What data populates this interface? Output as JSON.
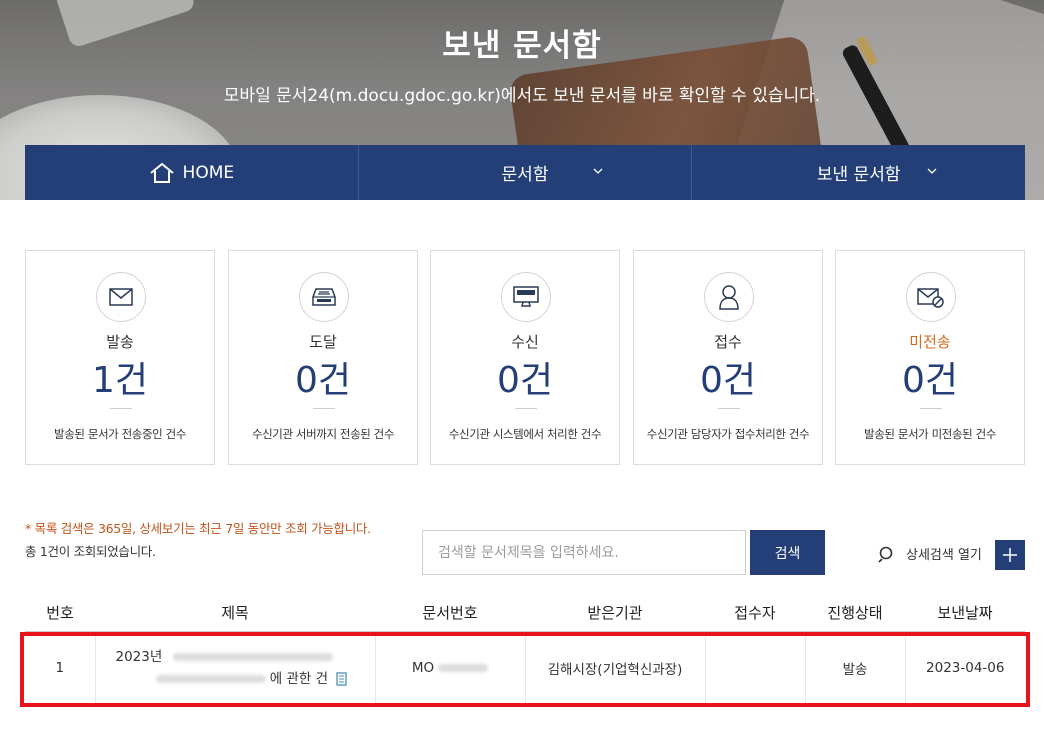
{
  "hero": {
    "title": "보낸 문서함",
    "subtitle": "모바일 문서24(m.docu.gdoc.go.kr)에서도 보낸 문서를 바로 확인할 수 있습니다."
  },
  "nav": {
    "home_label": "HOME",
    "docbox_label": "문서함",
    "sent_label": "보낸 문서함"
  },
  "cards": [
    {
      "icon": "envelope-icon",
      "label": "발송",
      "count": "1건",
      "desc": "발송된 문서가 전송중인 건수"
    },
    {
      "icon": "server-tray-icon",
      "label": "도달",
      "count": "0건",
      "desc": "수신기관 서버까지 전송된 건수"
    },
    {
      "icon": "system-monitor-icon",
      "label": "수신",
      "count": "0건",
      "desc": "수신기관 시스템에서 처리한 건수"
    },
    {
      "icon": "person-icon",
      "label": "접수",
      "count": "0건",
      "desc": "수신기관 담당자가 접수처리한 건수"
    },
    {
      "icon": "envelope-blocked-icon",
      "label": "미전송",
      "count": "0건",
      "desc": "발송된 문서가 미전송된 건수"
    }
  ],
  "search": {
    "notice": "* 목록 검색은 365일, 상세보기는 최근 7일 동안만 조회 가능합니다.",
    "result_count": "총 1건이 조회되었습니다.",
    "placeholder": "검색할 문서제목을 입력하세요.",
    "button_label": "검색",
    "detail_label": "상세검색 열기"
  },
  "table": {
    "headers": [
      "번호",
      "제목",
      "문서번호",
      "받은기관",
      "접수자",
      "진행상태",
      "보낸날짜"
    ],
    "rows": [
      {
        "no": "1",
        "title_line1": "2023년",
        "title_line2": "에 관한 건",
        "doc_no": "MO",
        "receiver": "김해시장(기업혁신과장)",
        "receiver_person": "",
        "status": "발송",
        "date": "2023-04-06"
      }
    ]
  },
  "colors": {
    "navy": "#243f78",
    "alert_orange": "#d2691e",
    "highlight_red": "#e8141b"
  }
}
